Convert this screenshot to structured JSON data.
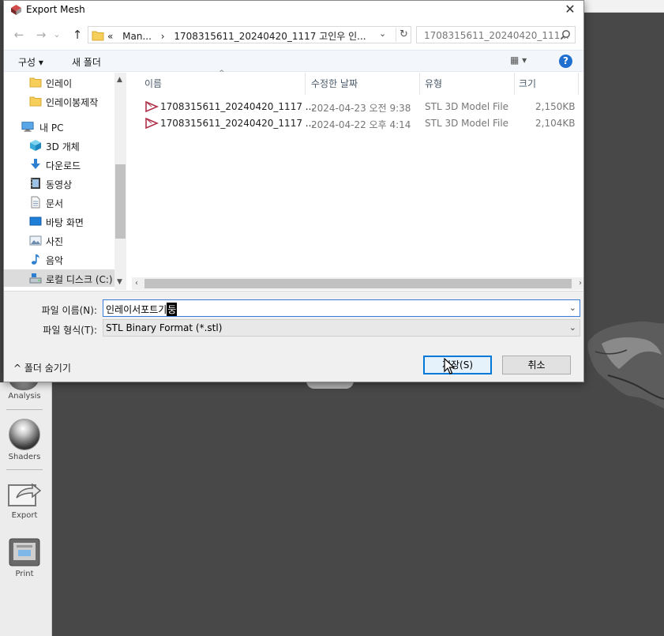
{
  "dialog": {
    "title": "Export Mesh",
    "close_glyph": "✕"
  },
  "nav": {
    "back_glyph": "←",
    "forward_glyph": "→",
    "chevron_glyph": "⌄",
    "up_glyph": "↑",
    "breadcrumbs": [
      "«",
      "Man...",
      "›",
      "1708315611_20240420_1117 고인우 인..."
    ],
    "search_placeholder": "1708315611_20240420_111...",
    "refresh_glyph": "↻",
    "dropdown_glyph": "⌄"
  },
  "toolbar": {
    "organize_label": "구성 ▾",
    "new_folder_label": "새 폴더",
    "view_label": "▦ ▾",
    "help_label": "?"
  },
  "tree": {
    "items": [
      {
        "label": "인레이",
        "icon": "folder-icon"
      },
      {
        "label": "인레이봉제작",
        "icon": "folder-icon"
      },
      {
        "label": "내 PC",
        "icon": "pc-icon"
      },
      {
        "label": "3D 개체",
        "icon": "3d-objects-icon"
      },
      {
        "label": "다운로드",
        "icon": "download-icon"
      },
      {
        "label": "동영상",
        "icon": "video-icon"
      },
      {
        "label": "문서",
        "icon": "document-icon"
      },
      {
        "label": "바탕 화면",
        "icon": "desktop-icon"
      },
      {
        "label": "사진",
        "icon": "pictures-icon"
      },
      {
        "label": "음악",
        "icon": "music-icon"
      },
      {
        "label": "로컬 디스크 (C:)",
        "icon": "drive-icon"
      }
    ]
  },
  "files": {
    "columns": [
      "이름",
      "수정한 날짜",
      "유형",
      "크기"
    ],
    "sort_glyph": "^",
    "rows": [
      {
        "name": "1708315611_20240420_1117 ...",
        "date": "2024-04-23 오전 9:38",
        "type": "STL 3D Model File",
        "size": "2,150KB"
      },
      {
        "name": "1708315611_20240420_1117 ...",
        "date": "2024-04-22 오후 4:14",
        "type": "STL 3D Model File",
        "size": "2,104KB"
      }
    ]
  },
  "form": {
    "filename_label": "파일 이름(N):",
    "filename_value": "인레이서포트기",
    "filename_caret_char": "둥",
    "filetype_label": "파일 형식(T):",
    "filetype_value": "STL Binary Format (*.stl)",
    "hide_folders_label": "^  폴더 숨기기",
    "save_label": "저장(S)",
    "cancel_label": "취소"
  },
  "app": {
    "tools": [
      "Analysis",
      "Shaders",
      "Export",
      "Print"
    ]
  },
  "colors": {
    "accent": "#0078d7",
    "help": "#1e6fd0",
    "stl_icon": "#b0324a",
    "background": "#484848"
  }
}
